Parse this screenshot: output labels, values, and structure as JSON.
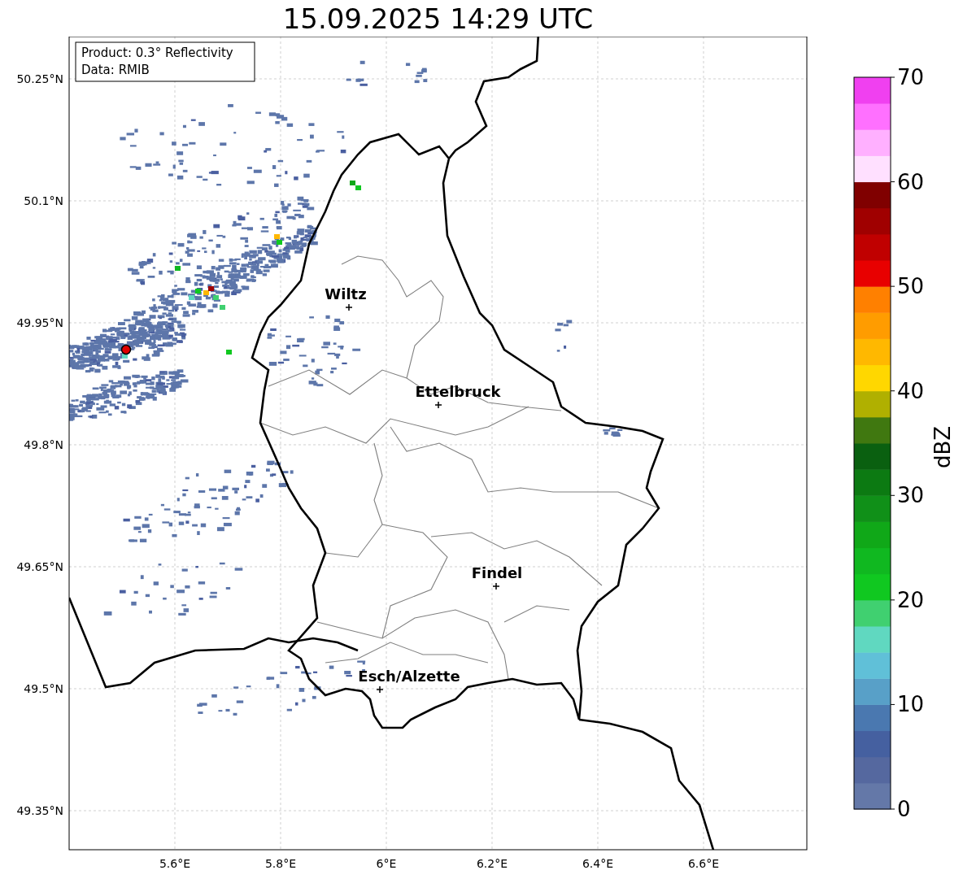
{
  "title": "15.09.2025 14:29 UTC",
  "info_box": [
    "Product: 0.3° Reflectivity",
    "Data: RMIB"
  ],
  "map": {
    "lat_ticks": [
      "50.25°N",
      "50.1°N",
      "49.95°N",
      "49.8°N",
      "49.65°N",
      "49.5°N",
      "49.35°N"
    ],
    "lon_ticks": [
      "5.6°E",
      "5.8°E",
      "6°E",
      "6.2°E",
      "6.4°E",
      "6.6°E"
    ],
    "cities": [
      "Wiltz",
      "Ettelbruck",
      "Findel",
      "Esch/Alzette"
    ]
  },
  "colorbar": {
    "label": "dBZ",
    "ticks": [
      "70",
      "60",
      "50",
      "40",
      "30",
      "20",
      "10",
      "0"
    ]
  }
}
